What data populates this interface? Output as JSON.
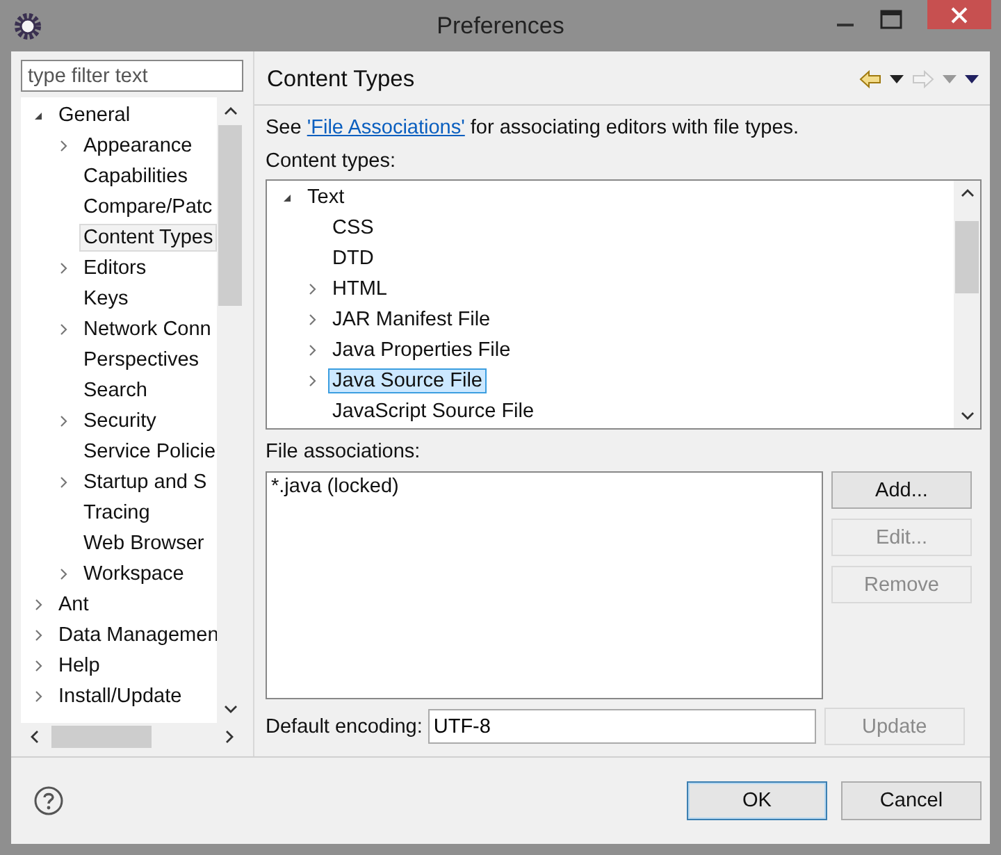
{
  "window": {
    "title": "Preferences"
  },
  "filter": {
    "placeholder": "type filter text"
  },
  "nav_tree": [
    {
      "label": "General",
      "expanded": true,
      "selected": false,
      "children": [
        {
          "label": "Appearance",
          "expanded": false,
          "selected": false
        },
        {
          "label": "Capabilities",
          "selected": false
        },
        {
          "label": "Compare/Patc",
          "selected": false
        },
        {
          "label": "Content Types",
          "selected": true
        },
        {
          "label": "Editors",
          "expanded": false,
          "selected": false
        },
        {
          "label": "Keys",
          "selected": false
        },
        {
          "label": "Network Conn",
          "expanded": false,
          "selected": false
        },
        {
          "label": "Perspectives",
          "selected": false
        },
        {
          "label": "Search",
          "selected": false
        },
        {
          "label": "Security",
          "expanded": false,
          "selected": false
        },
        {
          "label": "Service Policie",
          "selected": false
        },
        {
          "label": "Startup and S",
          "expanded": false,
          "selected": false
        },
        {
          "label": "Tracing",
          "selected": false
        },
        {
          "label": "Web Browser",
          "selected": false
        },
        {
          "label": "Workspace",
          "expanded": false,
          "selected": false
        }
      ]
    },
    {
      "label": "Ant",
      "expanded": false,
      "selected": false
    },
    {
      "label": "Data Managemen",
      "expanded": false,
      "selected": false
    },
    {
      "label": "Help",
      "expanded": false,
      "selected": false
    },
    {
      "label": "Install/Update",
      "expanded": false,
      "selected": false
    }
  ],
  "page": {
    "title": "Content Types",
    "intro": {
      "before": "See ",
      "link": "'File Associations'",
      "after": " for associating editors with file types."
    },
    "content_types_label": "Content types:",
    "content_types": [
      {
        "label": "Text",
        "expanded": true,
        "selected": false,
        "children": [
          {
            "label": "CSS",
            "selected": false
          },
          {
            "label": "DTD",
            "selected": false
          },
          {
            "label": "HTML",
            "expanded": false,
            "selected": false
          },
          {
            "label": "JAR Manifest File",
            "expanded": false,
            "selected": false
          },
          {
            "label": "Java Properties File",
            "expanded": false,
            "selected": false
          },
          {
            "label": "Java Source File",
            "expanded": false,
            "selected": true
          },
          {
            "label": "JavaScript Source File",
            "selected": false
          }
        ]
      }
    ],
    "file_associations_label": "File associations:",
    "file_associations": [
      "*.java (locked)"
    ],
    "association_buttons": [
      {
        "label": "Add...",
        "disabled": false
      },
      {
        "label": "Edit...",
        "disabled": true
      },
      {
        "label": "Remove",
        "disabled": true
      }
    ],
    "encoding": {
      "label": "Default encoding:",
      "value": "UTF-8",
      "button": {
        "label": "Update",
        "disabled": true
      }
    }
  },
  "buttons": [
    {
      "label": "OK",
      "default": true
    },
    {
      "label": "Cancel",
      "default": false
    }
  ]
}
